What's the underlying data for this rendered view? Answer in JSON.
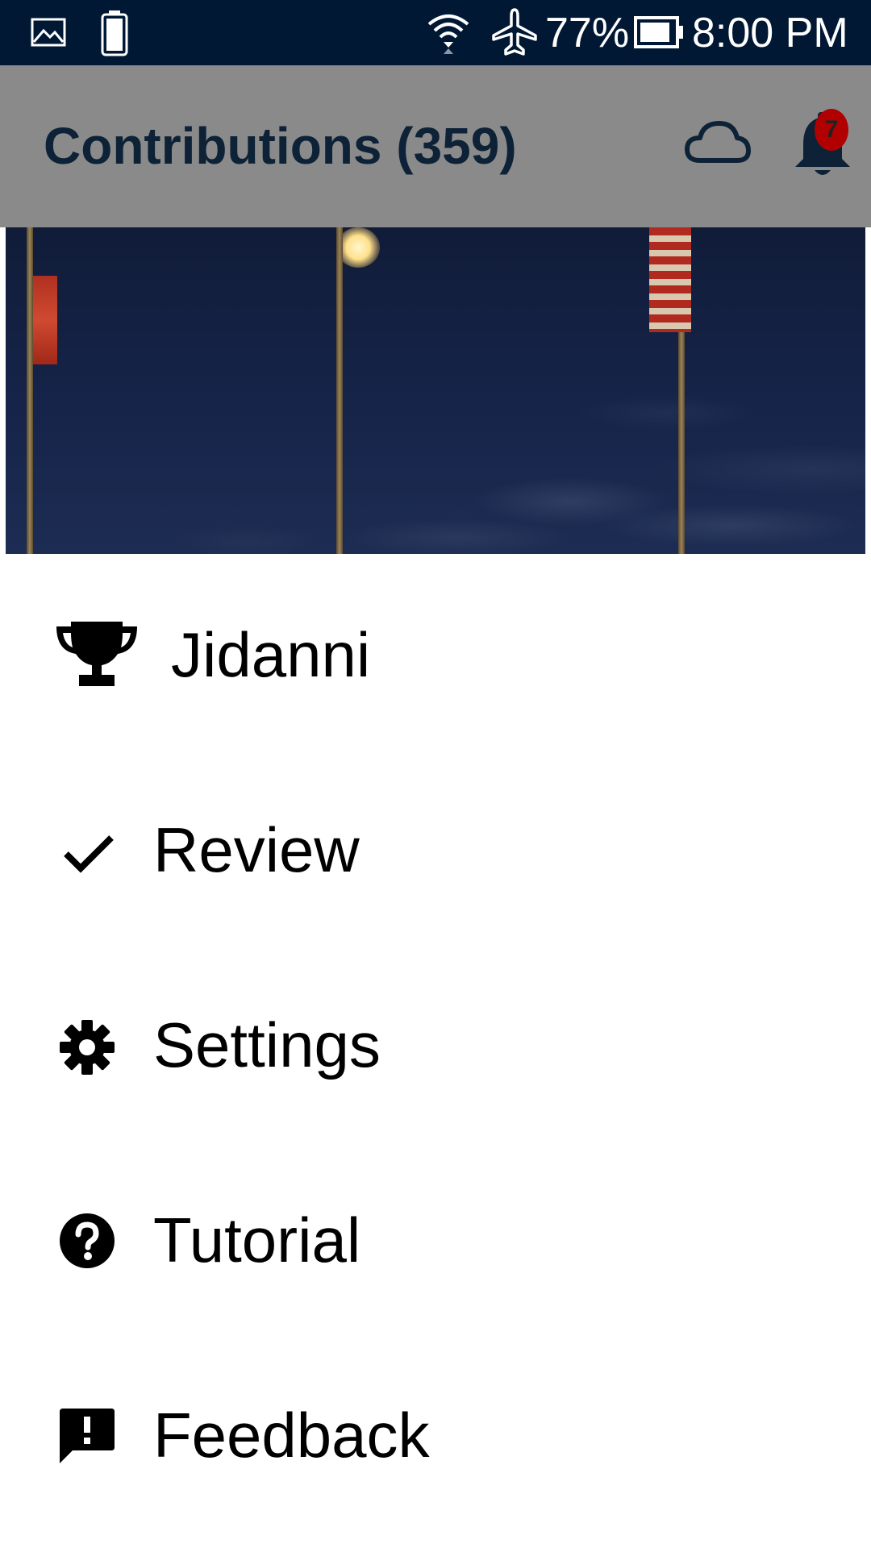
{
  "status_bar": {
    "battery_percent": "77%",
    "time": "8:00 PM",
    "icons": [
      "gallery-icon",
      "battery-full-icon",
      "wifi-icon",
      "airplane-icon",
      "battery-icon"
    ]
  },
  "app_bar": {
    "title": "Contributions (359)",
    "notification_count": "7",
    "icons": [
      "cloud-icon",
      "bell-icon"
    ]
  },
  "drawer": {
    "items": [
      {
        "label": "Jidanni",
        "icon": "trophy-icon"
      },
      {
        "label": "Review",
        "icon": "check-icon"
      },
      {
        "label": "Settings",
        "icon": "gear-icon"
      },
      {
        "label": "Tutorial",
        "icon": "help-icon"
      },
      {
        "label": "Feedback",
        "icon": "feedback-icon"
      }
    ]
  },
  "colors": {
    "status_bar": "#001833",
    "title_text": "#0d2236",
    "badge": "#b00000"
  }
}
